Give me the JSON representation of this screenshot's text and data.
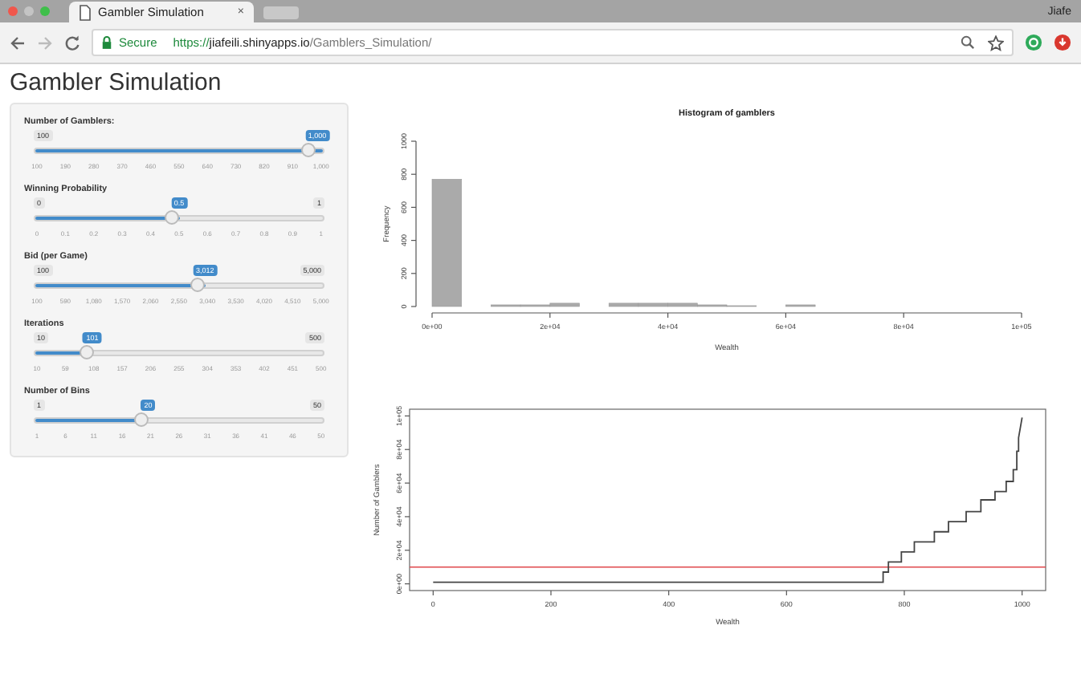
{
  "browser": {
    "tab_title": "Gambler Simulation",
    "tab_close": "×",
    "profile": "Jiafe",
    "security": "Secure",
    "url": {
      "scheme": "https://",
      "host": "jiafeili.shinyapps.io",
      "path": "/Gamblers_Simulation/"
    }
  },
  "page_title": "Gambler Simulation",
  "sliders": [
    {
      "label": "Number of Gamblers:",
      "min": "100",
      "value": "1,000",
      "level": 1,
      "ticks": [
        "100",
        "190",
        "280",
        "370",
        "460",
        "550",
        "640",
        "730",
        "820",
        "910",
        "1,000"
      ]
    },
    {
      "label": "Winning Probability",
      "min": "0",
      "max": "1",
      "value": "0.5",
      "level": 0.5,
      "ticks": [
        "0",
        "0.1",
        "0.2",
        "0.3",
        "0.4",
        "0.5",
        "0.6",
        "0.7",
        "0.8",
        "0.9",
        "1"
      ]
    },
    {
      "label": "Bid (per Game)",
      "min": "100",
      "max": "5,000",
      "value": "3,012",
      "level": 0.594,
      "ticks": [
        "100",
        "590",
        "1,080",
        "1,570",
        "2,060",
        "2,550",
        "3,040",
        "3,530",
        "4,020",
        "4,510",
        "5,000"
      ]
    },
    {
      "label": "Iterations",
      "min": "10",
      "max": "500",
      "value": "101",
      "level": 0.186,
      "ticks": [
        "10",
        "59",
        "108",
        "157",
        "206",
        "255",
        "304",
        "353",
        "402",
        "451",
        "500"
      ]
    },
    {
      "label": "Number of Bins",
      "min": "1",
      "max": "50",
      "value": "20",
      "level": 0.388,
      "ticks": [
        "1",
        "6",
        "11",
        "16",
        "21",
        "26",
        "31",
        "36",
        "41",
        "46",
        "50"
      ]
    }
  ],
  "histogram": {
    "chart_data": {
      "type": "bar",
      "title": "Histogram of gamblers",
      "xlabel": "Wealth",
      "ylabel": "Frequency",
      "x": [
        2500,
        7500,
        12500,
        17500,
        22500,
        27500,
        32500,
        37500,
        42500,
        47500,
        52500,
        57500,
        62500,
        67500,
        72500,
        77500,
        82500,
        87500,
        92500,
        97500
      ],
      "values": [
        770,
        0,
        10,
        10,
        20,
        0,
        20,
        20,
        20,
        10,
        5,
        0,
        10,
        0,
        0,
        0,
        0,
        0,
        0,
        0
      ],
      "xlim": [
        0,
        100000
      ],
      "ylim": [
        0,
        1000
      ],
      "xticks": [
        {
          "value": 0,
          "label": "0e+00"
        },
        {
          "value": 20000,
          "label": "2e+04"
        },
        {
          "value": 40000,
          "label": "4e+04"
        },
        {
          "value": 60000,
          "label": "6e+04"
        },
        {
          "value": 80000,
          "label": "8e+04"
        },
        {
          "value": 100000,
          "label": "1e+05"
        }
      ],
      "yticks": [
        0,
        200,
        400,
        600,
        800,
        1000
      ]
    }
  },
  "wealth_plot": {
    "chart_data": {
      "type": "line",
      "xlabel": "Wealth",
      "ylabel": "Number of Gamblers",
      "x": [
        0,
        764,
        764,
        773,
        773,
        795,
        795,
        817,
        817,
        851,
        851,
        875,
        875,
        905,
        905,
        930,
        930,
        954,
        954,
        973,
        973,
        985,
        985,
        991,
        991,
        994,
        994,
        1000
      ],
      "series": [
        {
          "color": "#444444",
          "values": [
            1000,
            1000,
            7000,
            7000,
            13000,
            13000,
            19000,
            19000,
            25000,
            25000,
            31000,
            31000,
            37000,
            37000,
            43000,
            43000,
            50000,
            50000,
            55000,
            55000,
            61000,
            61000,
            68000,
            68000,
            79000,
            79000,
            87000,
            99000
          ]
        }
      ],
      "xlim": [
        -40,
        1040
      ],
      "ylim": [
        -4000,
        104000
      ],
      "xticks": [
        0,
        200,
        400,
        600,
        800,
        1000
      ],
      "yticks": [
        {
          "value": 0,
          "label": "0e+00"
        },
        {
          "value": 20000,
          "label": "2e+04"
        },
        {
          "value": 40000,
          "label": "4e+04"
        },
        {
          "value": 60000,
          "label": "6e+04"
        },
        {
          "value": 80000,
          "label": "8e+04"
        },
        {
          "value": 100000,
          "label": "1e+05"
        }
      ],
      "ref_lines": [
        {
          "axis": "y",
          "value": 10000,
          "color": "#e0484c"
        }
      ]
    }
  }
}
